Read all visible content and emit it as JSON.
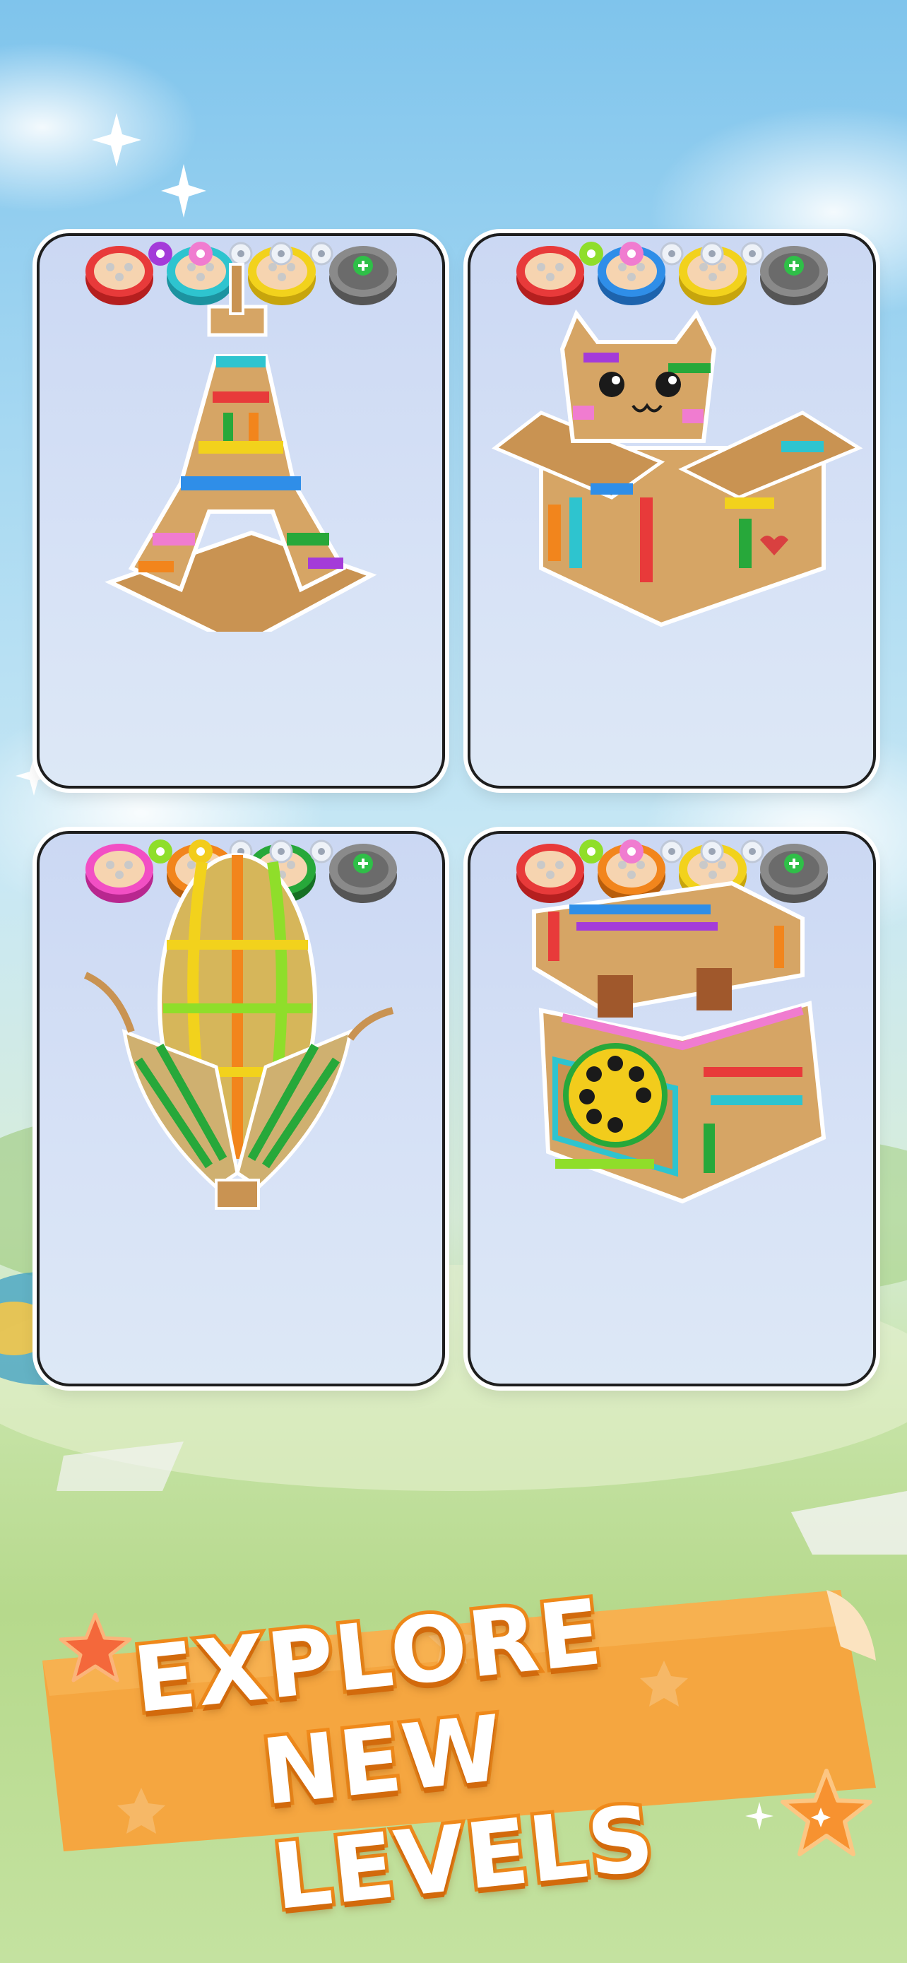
{
  "banner": {
    "line1": "EXPLORE",
    "line2": "NEW LEVELS"
  },
  "colors": {
    "card_border": "#1e1e1e",
    "banner_fill": "#f5a640",
    "banner_text_stroke": "#f08a1b"
  },
  "levels": [
    {
      "name": "eiffel-tower",
      "slots": [
        "#e83a3a",
        "#2ec4cf",
        "#f2d21c",
        "locked"
      ],
      "progress_dots": [
        "#a43bd9",
        "#f07cd0",
        "empty",
        "empty",
        "empty"
      ],
      "model_icon": "eiffel-tower-model"
    },
    {
      "name": "cat-in-box",
      "slots": [
        "#e83a3a",
        "#2f8ee8",
        "#f2d21c",
        "locked"
      ],
      "progress_dots": [
        "#8fde2a",
        "#f07cd0",
        "empty",
        "empty",
        "empty"
      ],
      "model_icon": "cat-box-model"
    },
    {
      "name": "corn",
      "slots": [
        "#f24fc4",
        "#f2851c",
        "#27a83a",
        "locked"
      ],
      "progress_dots": [
        "#8fde2a",
        "#f2cc1c",
        "empty",
        "empty",
        "empty"
      ],
      "model_icon": "corn-model"
    },
    {
      "name": "rotary-phone",
      "slots": [
        "#e83a3a",
        "#f2851c",
        "#f2d21c",
        "locked"
      ],
      "progress_dots": [
        "#8fde2a",
        "#f07cd0",
        "empty",
        "empty",
        "empty"
      ],
      "model_icon": "phone-model"
    }
  ]
}
